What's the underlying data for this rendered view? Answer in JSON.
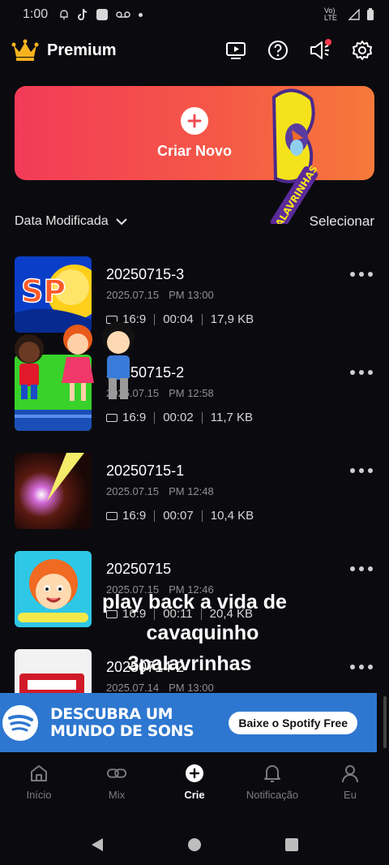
{
  "status_bar": {
    "time": "1:00",
    "network": "Vo) LTE"
  },
  "header": {
    "title": "Premium"
  },
  "create": {
    "label": "Criar Novo"
  },
  "sticker": {
    "text": "PALAVRINHAS"
  },
  "sort": {
    "label": "Data Modificada",
    "select_label": "Selecionar"
  },
  "projects": [
    {
      "title": "20250715-3",
      "date": "2025.07.15",
      "time": "PM 13:00",
      "ratio": "16:9",
      "duration": "00:04",
      "size": "17,9 KB"
    },
    {
      "title": "20250715-2",
      "date": "2025.07.15",
      "time": "PM 12:58",
      "ratio": "16:9",
      "duration": "00:02",
      "size": "11,7 KB"
    },
    {
      "title": "20250715-1",
      "date": "2025.07.15",
      "time": "PM 12:48",
      "ratio": "16:9",
      "duration": "00:07",
      "size": "10,4 KB"
    },
    {
      "title": "20250715",
      "date": "2025.07.15",
      "time": "PM 12:46",
      "ratio": "16:9",
      "duration": "00:11",
      "size": "20,4 KB"
    },
    {
      "title": "20250714-2",
      "date": "2025.07.14",
      "time": "PM 13:00",
      "ratio": "",
      "duration": "",
      "size": ""
    }
  ],
  "overlay": {
    "line1": "play back a vida de",
    "line2": "cavaquinho",
    "line3": "3palavrinhas"
  },
  "ad": {
    "headline1": "DESCUBRA UM",
    "headline2": "MUNDO DE SONS",
    "cta": "Baixe o Spotify Free"
  },
  "nav": [
    {
      "label": "Início"
    },
    {
      "label": "Mix"
    },
    {
      "label": "Crie"
    },
    {
      "label": "Notificação"
    },
    {
      "label": "Eu"
    }
  ],
  "colors": {
    "accent_start": "#f23b58",
    "accent_end": "#f6793a",
    "background": "#0b0b0f",
    "ad_blue": "#2e77d0",
    "notif_red": "#ff3a4c"
  }
}
